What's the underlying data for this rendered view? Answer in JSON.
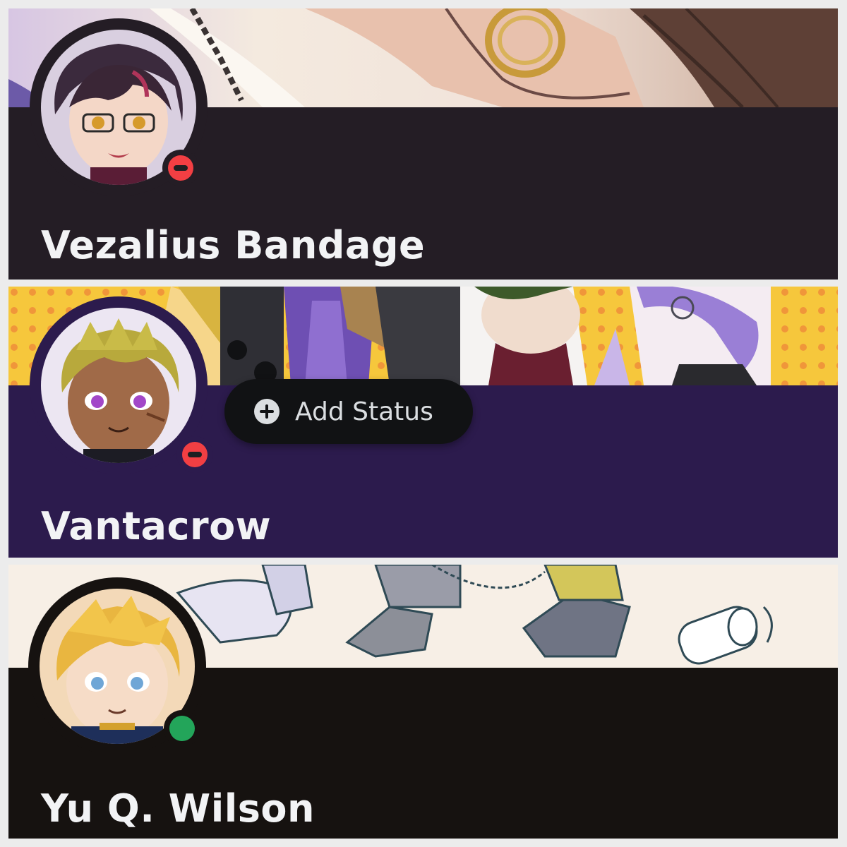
{
  "profiles": [
    {
      "display_name": "Vezalius Bandage",
      "status": "dnd",
      "colors": {
        "body": "#241d25",
        "banner_base": "#efe8ec"
      }
    },
    {
      "display_name": "Vantacrow",
      "status": "dnd",
      "colors": {
        "body": "#2c1b4d",
        "banner_base": "#f6c73c"
      },
      "add_status_label": "Add Status"
    },
    {
      "display_name": "Yu Q. Wilson",
      "status": "online",
      "colors": {
        "body": "#161210",
        "banner_base": "#f7efe6"
      }
    }
  ],
  "icons": {
    "add_status": "plus-circle-icon",
    "dnd": "do-not-disturb-status-icon",
    "online": "online-status-icon"
  }
}
